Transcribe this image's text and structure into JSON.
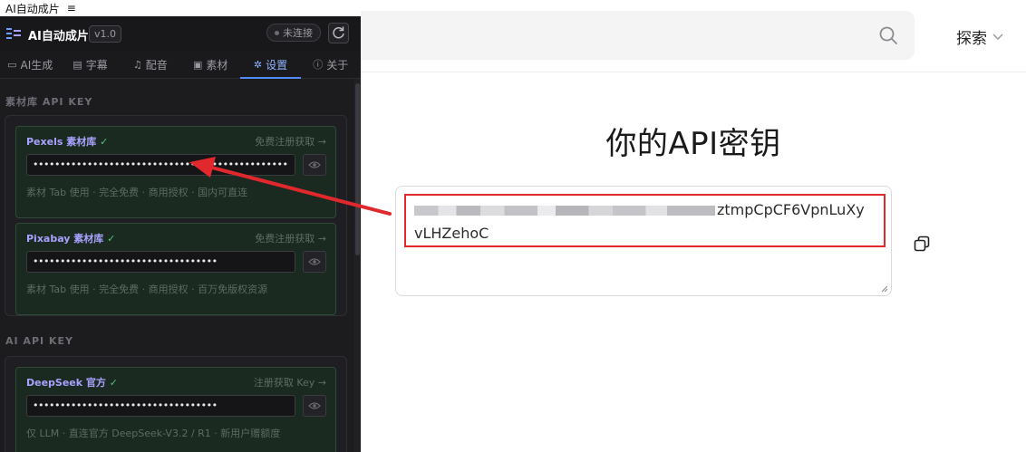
{
  "page": {
    "explore_label": "探索",
    "title": "你的API密钥",
    "api_key_visible": "ztmpCpCF6VpnLuXy",
    "api_key_line2": "vLHZehoC"
  },
  "panel": {
    "window_title": "AI自动成片",
    "app_name": "AI自动成片",
    "version": "v1.0",
    "status": "未连接",
    "tabs": [
      {
        "label": "AI生成",
        "icon": "▭",
        "active": false
      },
      {
        "label": "字幕",
        "icon": "▤",
        "active": false
      },
      {
        "label": "配音",
        "icon": "♫",
        "active": false
      },
      {
        "label": "素材",
        "icon": "▣",
        "active": false
      },
      {
        "label": "设置",
        "icon": "✲",
        "active": true
      },
      {
        "label": "关于",
        "icon": "ⓘ",
        "active": false
      }
    ],
    "section_material": "素材库 API KEY",
    "section_ai": "AI API KEY",
    "cards": [
      {
        "name": "Pexels 素材库",
        "check": "✓",
        "link": "免费注册获取 →",
        "masked": "•••••••••••••••••••••••••••••••••••••••••••••••",
        "desc": "素材 Tab 使用 · 完全免费 · 商用授权 · 国内可直连"
      },
      {
        "name": "Pixabay 素材库",
        "check": "✓",
        "link": "免费注册获取 →",
        "masked": "••••••••••••••••••••••••••••••••••",
        "desc": "素材 Tab 使用 · 完全免费 · 商用授权 · 百万免版权资源"
      },
      {
        "name": "DeepSeek 官方",
        "check": "✓",
        "link": "注册获取 Key →",
        "masked": "••••••••••••••••••••••••••••••••••",
        "desc": "仅 LLM · 直连官方 DeepSeek-V3.2 / R1 · 新用户赠额度"
      }
    ]
  },
  "colors": {
    "accent": "#4f8bff",
    "highlight": "#e0282d",
    "check": "#4ec27a",
    "card_title": "#a8a2ff"
  }
}
